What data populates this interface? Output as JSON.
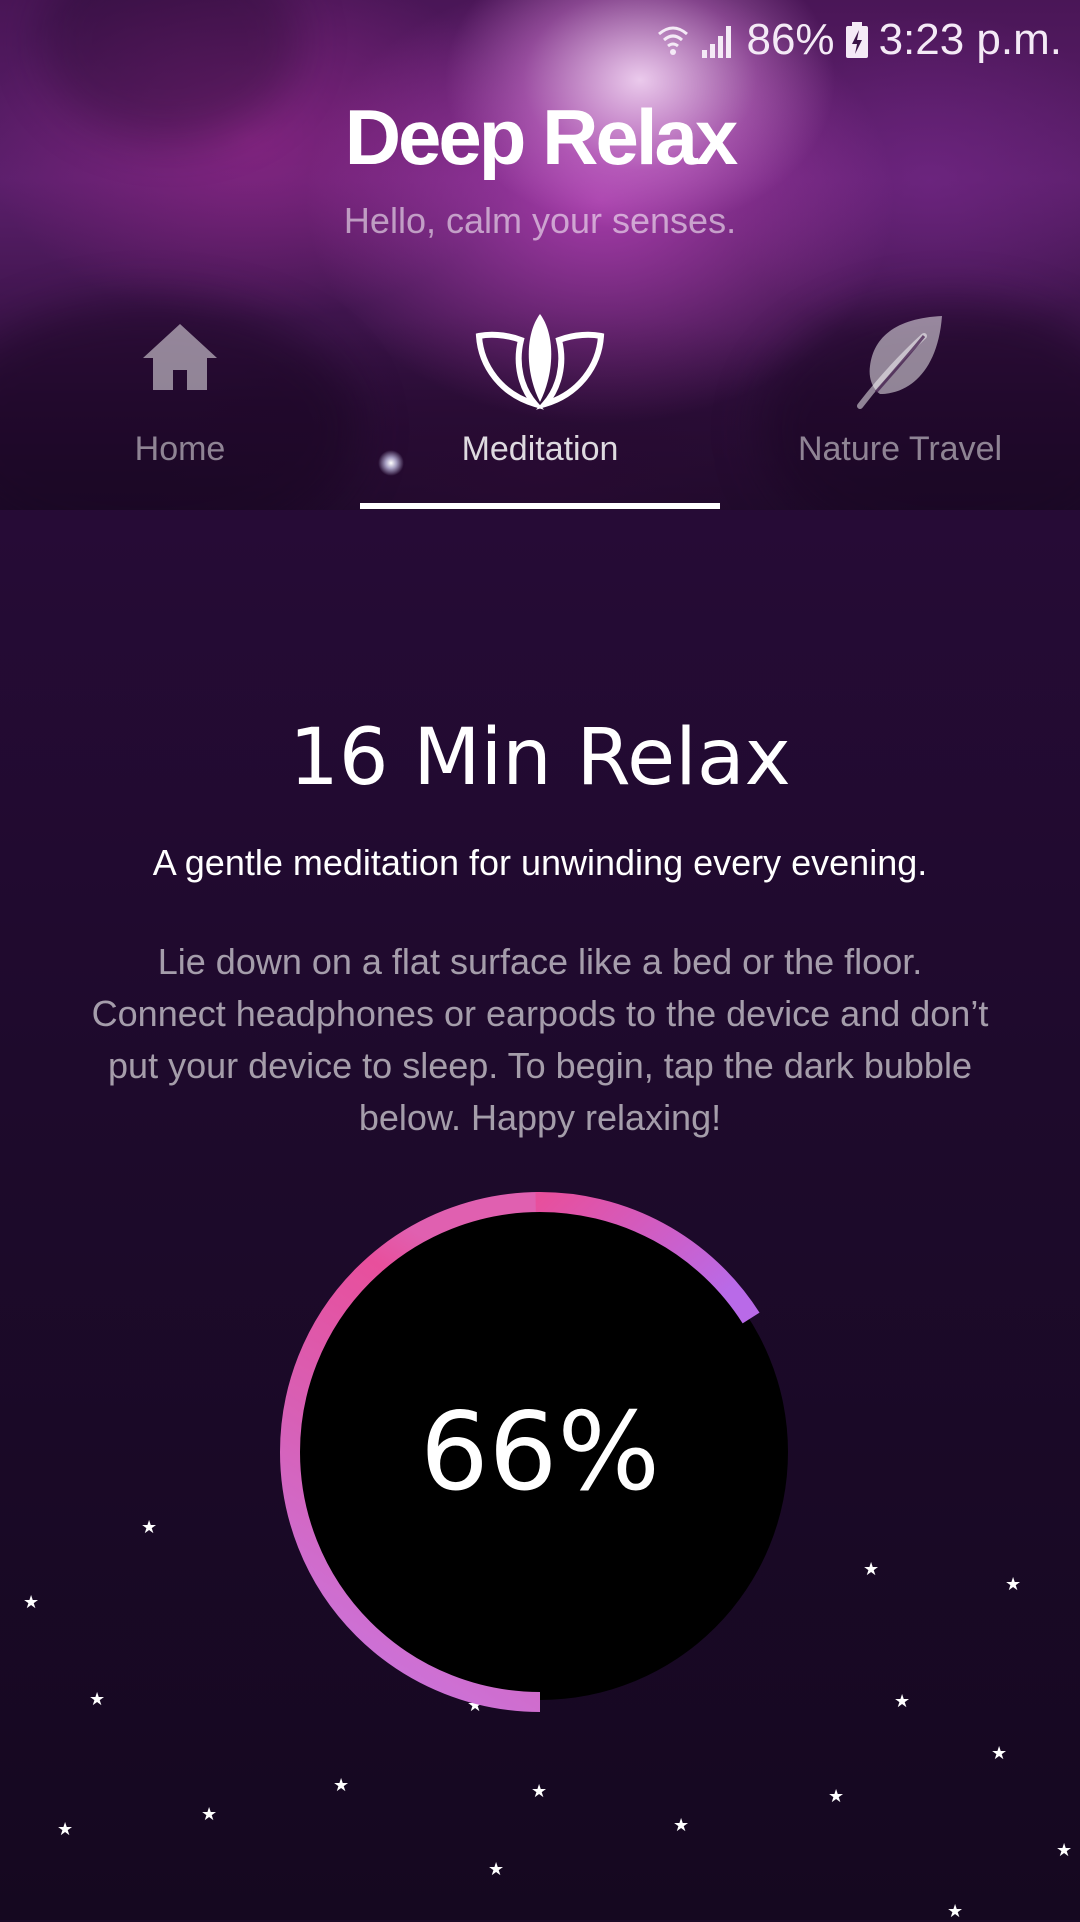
{
  "status_bar": {
    "battery": "86%",
    "time": "3:23 p.m.",
    "icons": [
      "wifi-icon",
      "signal-icon",
      "battery-charging-icon"
    ]
  },
  "header": {
    "title": "Deep Relax",
    "subtitle": "Hello, calm your senses."
  },
  "tabs": [
    {
      "label": "Home",
      "icon": "home-icon",
      "active": false
    },
    {
      "label": "Meditation",
      "icon": "lotus-icon",
      "active": true
    },
    {
      "label": "Nature Travel",
      "icon": "leaf-icon",
      "active": false
    }
  ],
  "session": {
    "title": "16 Min Relax",
    "tagline": "A gentle meditation for unwinding every evening.",
    "instructions": "Lie down on a flat surface like a bed or the floor. Connect headphones or earpods to the device and don’t put your device to sleep. To begin, tap the dark bubble below. Happy relaxing!"
  },
  "progress": {
    "label": "66%",
    "fraction": 0.66,
    "colors": {
      "start": "#c77ae6",
      "mid": "#e45fa8",
      "end": "#b96ae8",
      "bubble": "#000000"
    }
  },
  "colors": {
    "accent": "#ffffff",
    "background": "#1e0a2c"
  }
}
